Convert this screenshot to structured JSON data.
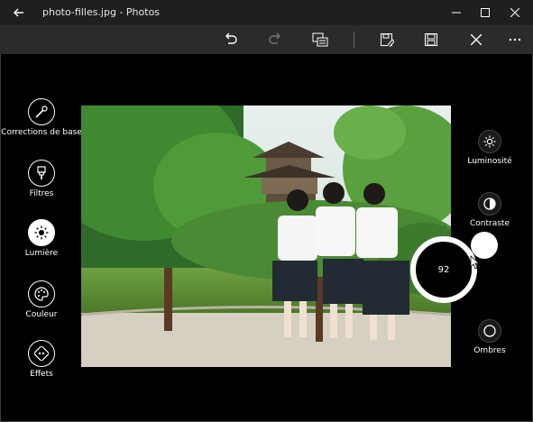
{
  "window": {
    "title": "photo-filles.jpg - Photos"
  },
  "toolbar": {
    "icons": [
      "undo-icon",
      "redo-icon",
      "compare-icon",
      "save-copy-icon",
      "save-icon",
      "close-icon",
      "more-icon"
    ],
    "redo_enabled": false
  },
  "left_nav": {
    "items": [
      {
        "label": "Corrections de base",
        "icon": "magic-wand-icon",
        "selected": false
      },
      {
        "label": "Filtres",
        "icon": "filter-icon",
        "selected": false
      },
      {
        "label": "Lumière",
        "icon": "sun-icon",
        "selected": true
      },
      {
        "label": "Couleur",
        "icon": "palette-icon",
        "selected": false
      },
      {
        "label": "Effets",
        "icon": "effects-icon",
        "selected": false
      }
    ]
  },
  "right_panel": {
    "items": [
      {
        "label": "Luminosité",
        "icon": "brightness-icon"
      },
      {
        "label": "Contraste",
        "icon": "contrast-icon"
      },
      {
        "label": "Ombres",
        "icon": "shadows-icon"
      }
    ]
  },
  "dial": {
    "value": "92"
  },
  "colors": {
    "titlebar": "#1f1f1f",
    "toolbar": "#2b2b2b",
    "background": "#000000"
  }
}
